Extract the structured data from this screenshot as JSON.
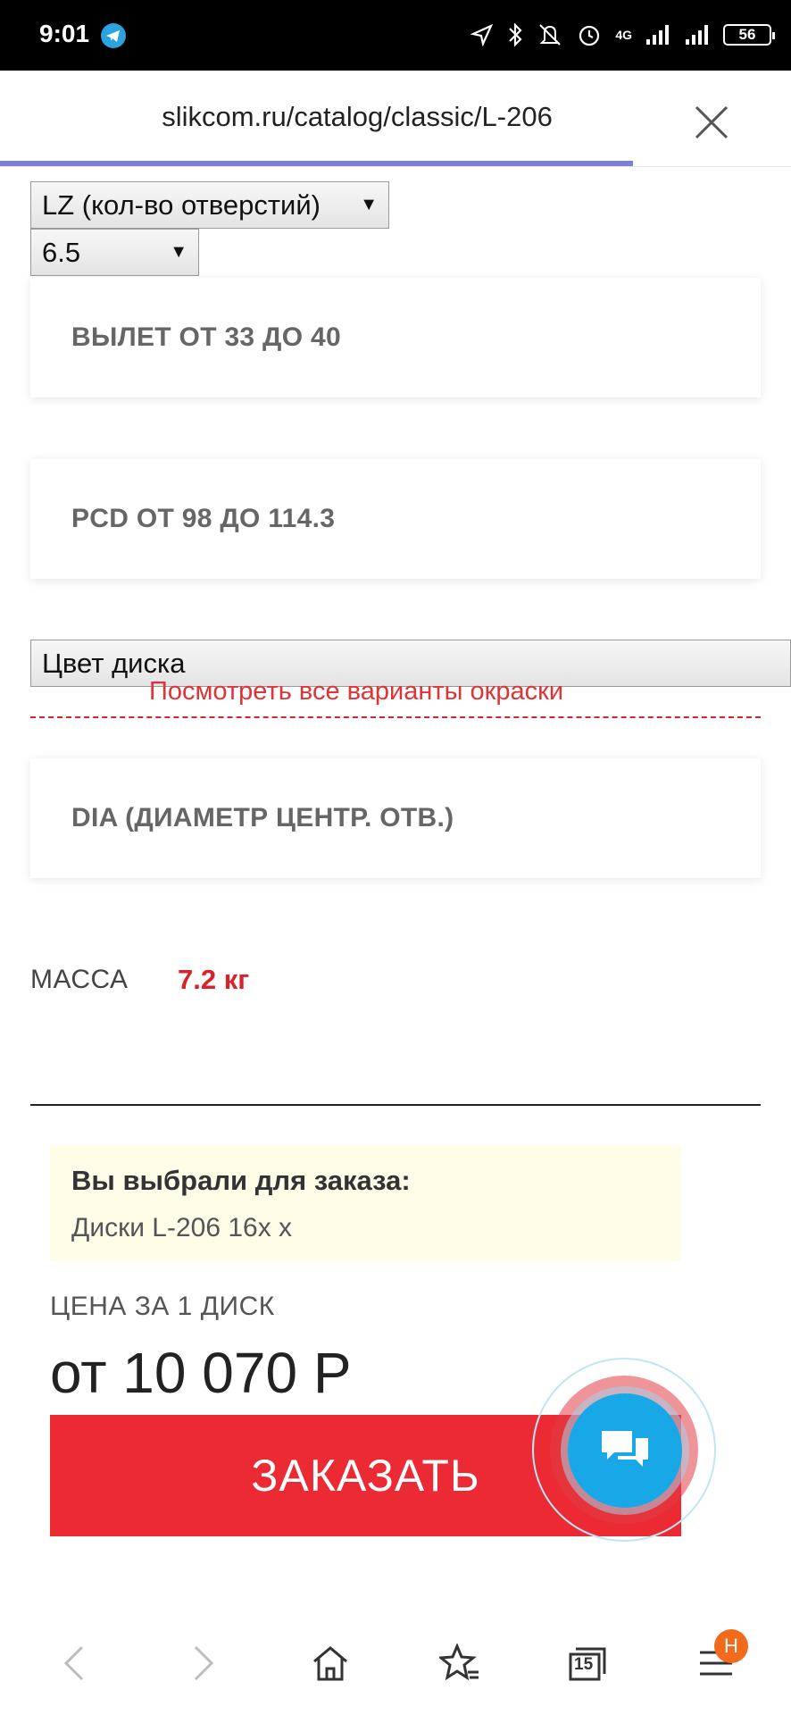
{
  "status_bar": {
    "time": "9:01",
    "battery": "56",
    "network": "4G",
    "icons": [
      "telegram-icon",
      "location-icon",
      "bluetooth-icon",
      "mute-icon",
      "alarm-icon",
      "signal-icon",
      "signal-icon-2",
      "battery-icon"
    ]
  },
  "browser": {
    "url": "slikcom.ru/catalog/classic/L-206",
    "close_icon": "close-icon",
    "progress_percent": 80,
    "accent_color": "#7b7fd3"
  },
  "filters": {
    "lz_select": "LZ (кол-во отверстий)",
    "width_select": "6.5",
    "vylet_card": "ВЫЛЕТ ОТ 33 ДО 40",
    "pcd_card": "PCD ОТ 98 ДО 114.3",
    "color_select": "Цвет диска",
    "paint_link": "Посмотреть все варианты окраски",
    "dia_card": "DIA (ДИАМЕТР ЦЕНТР. ОТВ.)"
  },
  "mass": {
    "label": "МАССА",
    "value": "7.2 кг"
  },
  "order": {
    "summary_title": "Вы выбрали для заказа:",
    "summary_item": "Диски L-206 16x x",
    "price_label": "ЦЕНА ЗА 1 ДИСК",
    "price": "от 10 070 Р",
    "button_label": "ЗАКАЗАТЬ",
    "button_color": "#ec2a34"
  },
  "chat": {
    "icon": "chat-icon",
    "color": "#18a8e8"
  },
  "bottom_nav": {
    "tab_count": "15",
    "menu_badge": "Н",
    "icons": [
      "back-icon",
      "forward-icon",
      "home-icon",
      "bookmarks-star-icon",
      "tabs-icon",
      "menu-icon"
    ]
  }
}
